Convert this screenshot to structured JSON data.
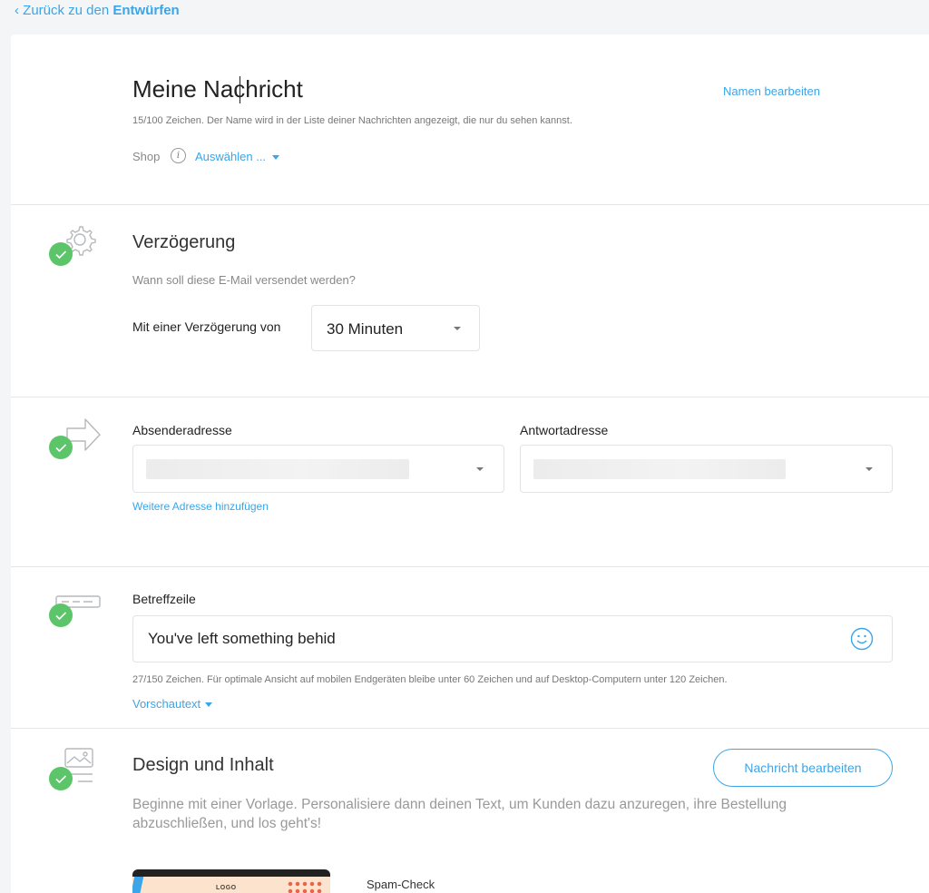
{
  "nav": {
    "back_prefix": "‹ Zurück zu den ",
    "back_target": "Entwürfen"
  },
  "name_section": {
    "title": "Meine Nachricht",
    "edit_link": "Namen bearbeiten",
    "hint": "15/100 Zeichen. Der Name wird in der Liste deiner Nachrichten angezeigt, die nur du sehen kannst.",
    "shop_label": "Shop",
    "info_glyph": "i",
    "shop_select": "Auswählen ..."
  },
  "delay_section": {
    "icon": "gear-icon",
    "title": "Verzögerung",
    "subtitle": "Wann soll diese E-Mail versendet werden?",
    "delay_label": "Mit einer Verzögerung von",
    "delay_value": "30 Minuten"
  },
  "address_section": {
    "icon": "arrow-right-icon",
    "sender_label": "Absenderadresse",
    "reply_label": "Antwortadresse",
    "add_address_link": "Weitere Adresse hinzufügen"
  },
  "subject_section": {
    "icon": "subject-line-icon",
    "label": "Betreffzeile",
    "value": "You've left something behid",
    "hint": "27/150 Zeichen. Für optimale Ansicht auf mobilen Endgeräten bleibe unter 60 Zeichen und auf Desktop-Computern unter 120 Zeichen.",
    "preview_link": "Vorschautext"
  },
  "design_section": {
    "icon": "image-content-icon",
    "title": "Design und Inhalt",
    "edit_button": "Nachricht bearbeiten",
    "description": "Beginne mit einer Vorlage. Personalisiere dann deinen Text, um Kunden dazu anzuregen, ihre Bestellung abzuschließen, und los geht's!",
    "thumbnail_logo": "LOGO",
    "spam_check": "Spam-Check"
  },
  "colors": {
    "accent": "#3aa5e8",
    "success": "#5cc56a"
  }
}
